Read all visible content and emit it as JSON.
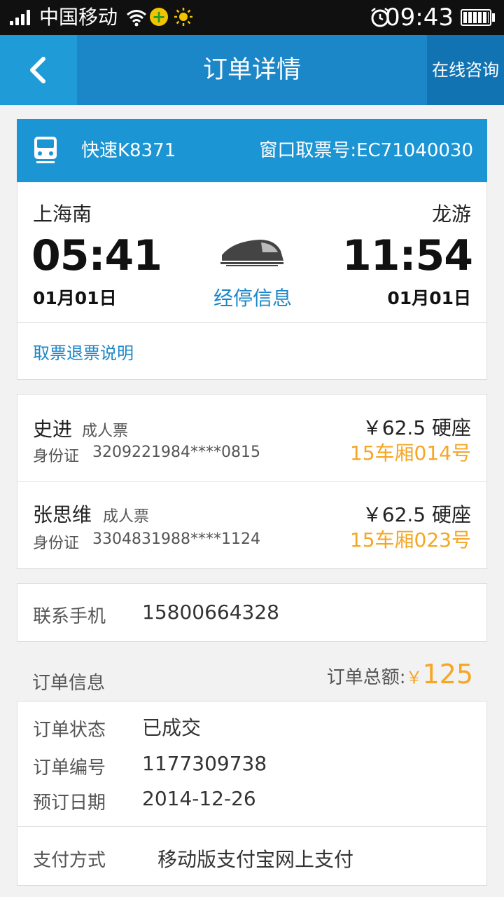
{
  "status_bar": {
    "carrier": "中国移动",
    "time": "09:43",
    "icons": [
      "signal-icon",
      "wifi-icon",
      "plus-app-icon",
      "sun-icon",
      "alarm-icon",
      "battery-icon"
    ]
  },
  "header": {
    "title": "订单详情",
    "right_button": "在线咨询",
    "back_icon": "back-chevron-icon",
    "color": "#1b86c8"
  },
  "train": {
    "name": "快速K8371",
    "pickup_number": "窗口取票号:EC71040030",
    "from_station": "上海南",
    "depart_time": "05:41",
    "depart_date": "01月01日",
    "to_station": "龙游",
    "arrive_time": "11:54",
    "arrive_date": "01月01日",
    "stops_link": "经停信息",
    "rules_link": "取票退票说明"
  },
  "passengers": [
    {
      "name": "史进",
      "ticket_type": "成人票",
      "id_label": "身份证",
      "id_number": "3209221984****0815",
      "price": "￥62.5 硬座",
      "seat": "15车厢014号"
    },
    {
      "name": "张思维",
      "ticket_type": "成人票",
      "id_label": "身份证",
      "id_number": "3304831988****1124",
      "price": "￥62.5 硬座",
      "seat": "15车厢023号"
    }
  ],
  "contact": {
    "label": "联系手机",
    "phone": "15800664328"
  },
  "order": {
    "section_title": "订单信息",
    "total_label": "订单总额:",
    "total_currency": "￥",
    "total_amount": "125",
    "status_label": "订单状态",
    "status": "已成交",
    "number_label": "订单编号",
    "number": "1177309738",
    "date_label": "预订日期",
    "date": "2014-12-26",
    "payment_label": "支付方式",
    "payment": "移动版支付宝网上支付"
  },
  "colors": {
    "accent": "#1b86c8",
    "seat_highlight": "#f5a623"
  }
}
